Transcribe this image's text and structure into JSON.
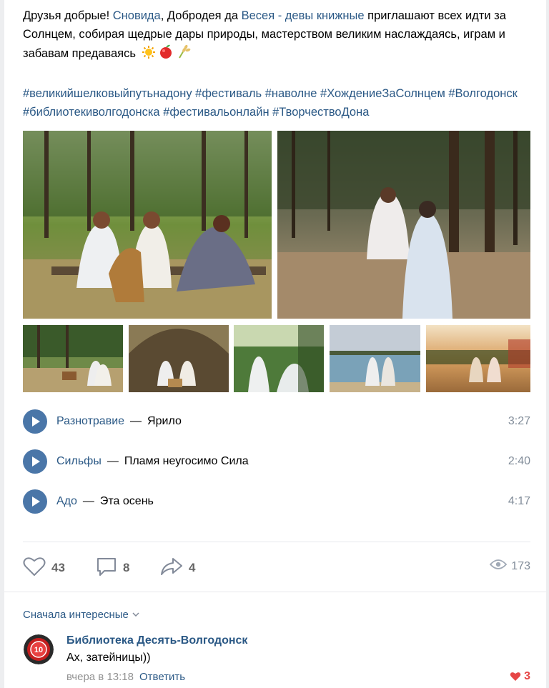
{
  "post": {
    "text_part1": "Друзья добрые! ",
    "mention1": "Сновида",
    "text_part2": ", Добродея да ",
    "mention2": "Весея - девы книжные",
    "text_part3": " приглашают всех идти за Солнцем, собирая щедрые дары природы, мастерством великим наслаждаясь, играм и забавам предаваясь",
    "hashtags": "#великийшелковыйпутьнадону #фестиваль #наволне #ХождениеЗаСолнцем #Волгодонск #библиотекиволгодонска #фестивальонлайн #ТворчествоДона",
    "emoji_icons": [
      "sun-icon",
      "apple-icon",
      "wheat-icon"
    ]
  },
  "tracks": [
    {
      "artist": "Разнотравие",
      "dash": "—",
      "title": "Ярило",
      "duration": "3:27"
    },
    {
      "artist": "Сильфы",
      "dash": "—",
      "title": "Пламя неугосимо Сила",
      "duration": "2:40"
    },
    {
      "artist": "Адо",
      "dash": "—",
      "title": "Эта осень",
      "duration": "4:17"
    }
  ],
  "actions": {
    "likes": "43",
    "comments": "8",
    "shares": "4",
    "views": "173"
  },
  "comments": {
    "sort_label": "Сначала интересные",
    "items": [
      {
        "author": "Библиотека Десять-Волгодонск",
        "text": "Ах, затейницы))",
        "time": "вчера в 13:18",
        "reply_label": "Ответить",
        "likes": "3",
        "avatar_label": "10"
      }
    ]
  },
  "colors": {
    "link": "#2a5885",
    "accent": "#4a76a8",
    "like": "#e64646"
  }
}
